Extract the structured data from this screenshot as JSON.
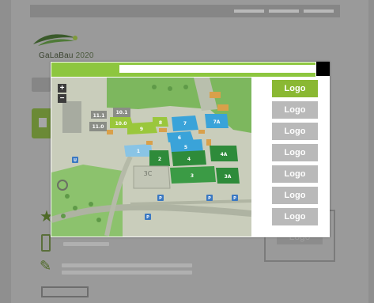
{
  "brand": {
    "name": "GaLaBau",
    "year": "2020"
  },
  "modal": {
    "title": "",
    "map": {
      "zoom_in_label": "+",
      "zoom_out_label": "−",
      "halls": [
        {
          "id": "10.1",
          "label": "10.1"
        },
        {
          "id": "11.1",
          "label": "11.1"
        },
        {
          "id": "11.0",
          "label": "11.0"
        },
        {
          "id": "10.0",
          "label": "10.0"
        },
        {
          "id": "9",
          "label": "9"
        },
        {
          "id": "8",
          "label": "8"
        },
        {
          "id": "7",
          "label": "7"
        },
        {
          "id": "7A",
          "label": "7A"
        },
        {
          "id": "6",
          "label": "6"
        },
        {
          "id": "5",
          "label": "5"
        },
        {
          "id": "4",
          "label": "4"
        },
        {
          "id": "4A",
          "label": "4A"
        },
        {
          "id": "3A",
          "label": "3A"
        },
        {
          "id": "3",
          "label": "3"
        },
        {
          "id": "2",
          "label": "2"
        },
        {
          "id": "1",
          "label": "1"
        },
        {
          "id": "3C",
          "label": "3C"
        }
      ],
      "parking_label": "P",
      "entrance_label": "U"
    },
    "logos": [
      {
        "label": "Logo",
        "active": true
      },
      {
        "label": "Logo",
        "active": false
      },
      {
        "label": "Logo",
        "active": false
      },
      {
        "label": "Logo",
        "active": false
      },
      {
        "label": "Logo",
        "active": false
      },
      {
        "label": "Logo",
        "active": false
      },
      {
        "label": "Logo",
        "active": false
      }
    ]
  },
  "background": {
    "right_button_label": "Logo"
  },
  "colors": {
    "accent_green": "#8dc63f",
    "logo_active": "#8ab833",
    "logo_inactive": "#b9b9b9",
    "hall_blue": "#3aa3d9",
    "hall_green": "#2e8b3a",
    "hall_lime": "#9ac73c"
  }
}
